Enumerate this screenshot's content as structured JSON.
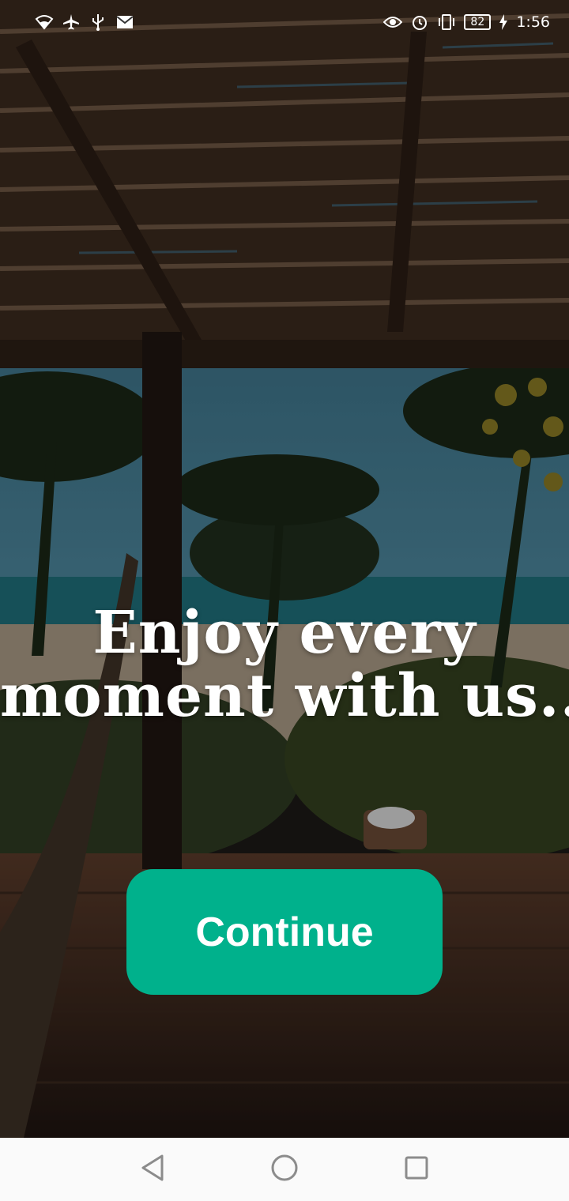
{
  "status_bar": {
    "battery_level": "82",
    "time": "1:56",
    "left_icons": [
      "wifi-icon",
      "airplane-icon",
      "usb-icon",
      "mail-icon"
    ],
    "right_icons": [
      "eye-icon",
      "alarm-icon",
      "vibrate-icon",
      "battery-icon",
      "charging-icon"
    ]
  },
  "hero": {
    "headline_line1": "Enjoy every",
    "headline_line2": "moment with us.."
  },
  "actions": {
    "continue_label": "Continue"
  },
  "navigation": {
    "buttons": [
      "back-icon",
      "home-icon",
      "recents-icon"
    ]
  },
  "colors": {
    "accent": "#00b18c",
    "nav_background": "#fafafa",
    "text": "#ffffff"
  }
}
